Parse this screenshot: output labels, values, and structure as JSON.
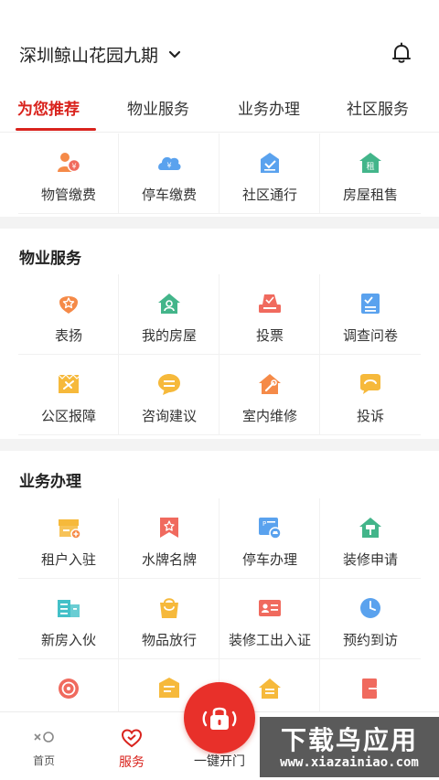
{
  "header": {
    "community": "深圳鲸山花园九期"
  },
  "tabs": [
    "为您推荐",
    "物业服务",
    "业务办理",
    "社区服务"
  ],
  "recommend": [
    {
      "label": "物管缴费",
      "icon": "property-fee-icon"
    },
    {
      "label": "停车缴费",
      "icon": "parking-fee-icon"
    },
    {
      "label": "社区通行",
      "icon": "community-pass-icon"
    },
    {
      "label": "房屋租售",
      "icon": "house-rent-icon"
    }
  ],
  "property": {
    "title": "物业服务",
    "items": [
      {
        "label": "表扬",
        "icon": "praise-icon"
      },
      {
        "label": "我的房屋",
        "icon": "my-house-icon"
      },
      {
        "label": "投票",
        "icon": "vote-icon"
      },
      {
        "label": "调查问卷",
        "icon": "survey-icon"
      },
      {
        "label": "公区报障",
        "icon": "public-repair-icon"
      },
      {
        "label": "咨询建议",
        "icon": "consult-icon"
      },
      {
        "label": "室内维修",
        "icon": "indoor-repair-icon"
      },
      {
        "label": "投诉",
        "icon": "complaint-icon"
      }
    ]
  },
  "business": {
    "title": "业务办理",
    "items": [
      {
        "label": "租户入驻",
        "icon": "tenant-icon"
      },
      {
        "label": "水牌名牌",
        "icon": "nameplate-icon"
      },
      {
        "label": "停车办理",
        "icon": "parking-apply-icon"
      },
      {
        "label": "装修申请",
        "icon": "renovation-icon"
      },
      {
        "label": "新房入伙",
        "icon": "move-in-icon"
      },
      {
        "label": "物品放行",
        "icon": "goods-release-icon"
      },
      {
        "label": "装修工出入证",
        "icon": "worker-pass-icon"
      },
      {
        "label": "预约到访",
        "icon": "visit-icon"
      }
    ]
  },
  "nav": {
    "home": "首页",
    "service": "服务",
    "door": "一键开门"
  },
  "watermark": {
    "title": "下载鸟应用",
    "url": "www.xiazainiao.com"
  },
  "colors": {
    "accent": "#d9231d",
    "orange": "#f58a48",
    "blue": "#5aa2ee",
    "green": "#43b58a",
    "yellow": "#f6b93b",
    "red": "#f06a5e"
  }
}
